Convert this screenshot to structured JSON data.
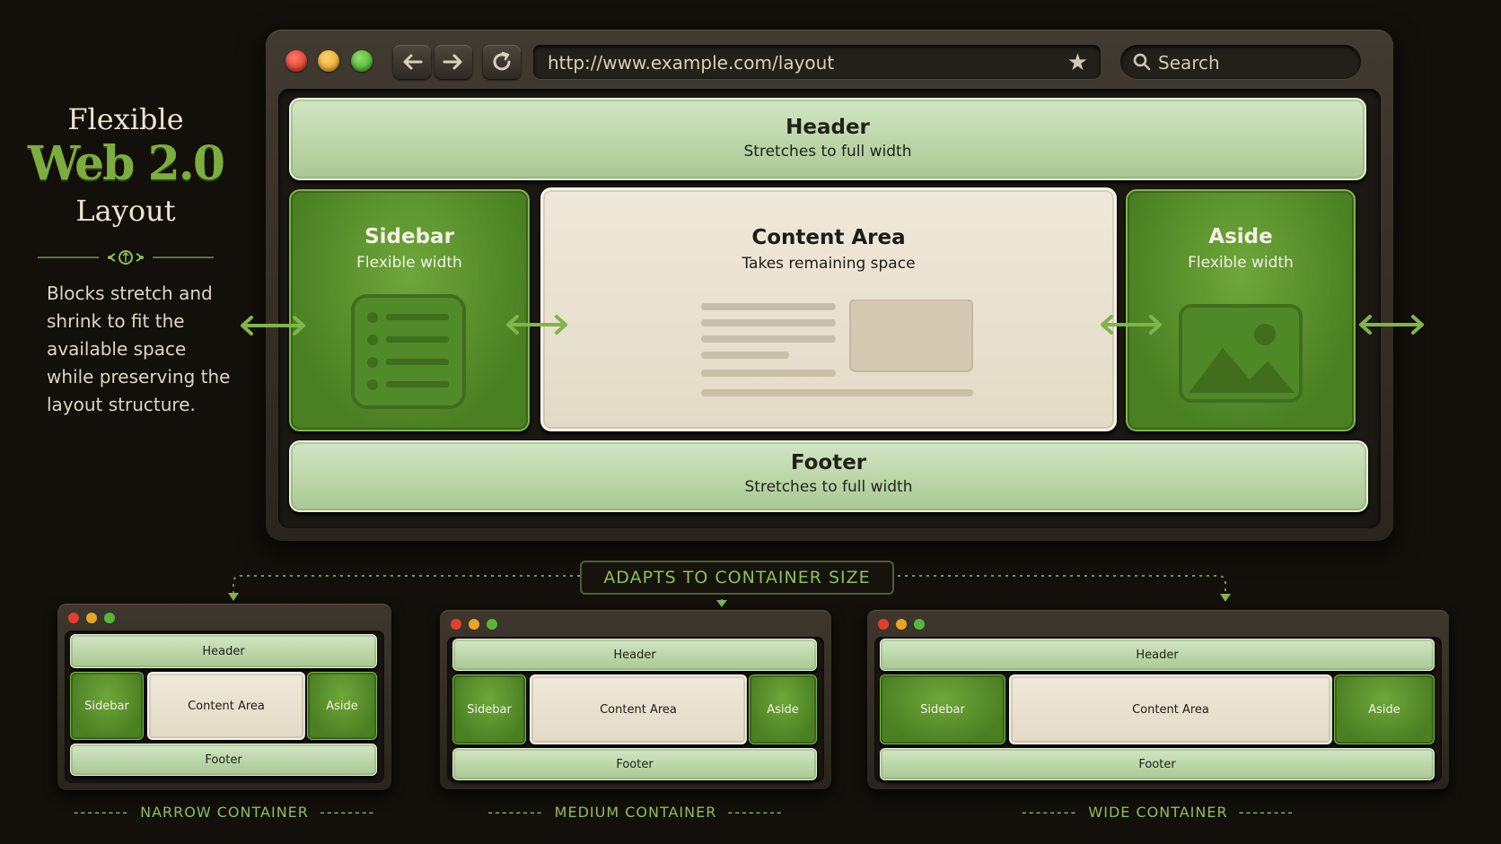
{
  "title": {
    "line1": "Flexible",
    "line2": "Web 2.0",
    "line3": "Layout"
  },
  "description": "Blocks stretch and shrink to fit the available space while preserving the layout structure.",
  "browser": {
    "url": "http://www.example.com/layout",
    "search_placeholder": "Search"
  },
  "blocks": {
    "header": {
      "title": "Header",
      "subtitle": "Stretches to full width"
    },
    "sidebar": {
      "title": "Sidebar",
      "subtitle": "Flexible width"
    },
    "content": {
      "title": "Content Area",
      "subtitle": "Takes remaining space"
    },
    "aside": {
      "title": "Aside",
      "subtitle": "Flexible width"
    },
    "footer": {
      "title": "Footer",
      "subtitle": "Stretches to full width"
    }
  },
  "adapts_label": "ADAPTS TO CONTAINER SIZE",
  "mini_labels": {
    "header": "Header",
    "sidebar": "Sidebar",
    "content": "Content Area",
    "aside": "Aside",
    "footer": "Footer"
  },
  "containers": {
    "narrow": "NARROW CONTAINER",
    "medium": "MEDIUM CONTAINER",
    "wide": "WIDE CONTAINER"
  },
  "colors": {
    "light_green": "#bcd8a8",
    "dark_green": "#5a9130",
    "cream": "#ebe4d3",
    "accent": "#8dbf59",
    "background": "#130f0a"
  }
}
